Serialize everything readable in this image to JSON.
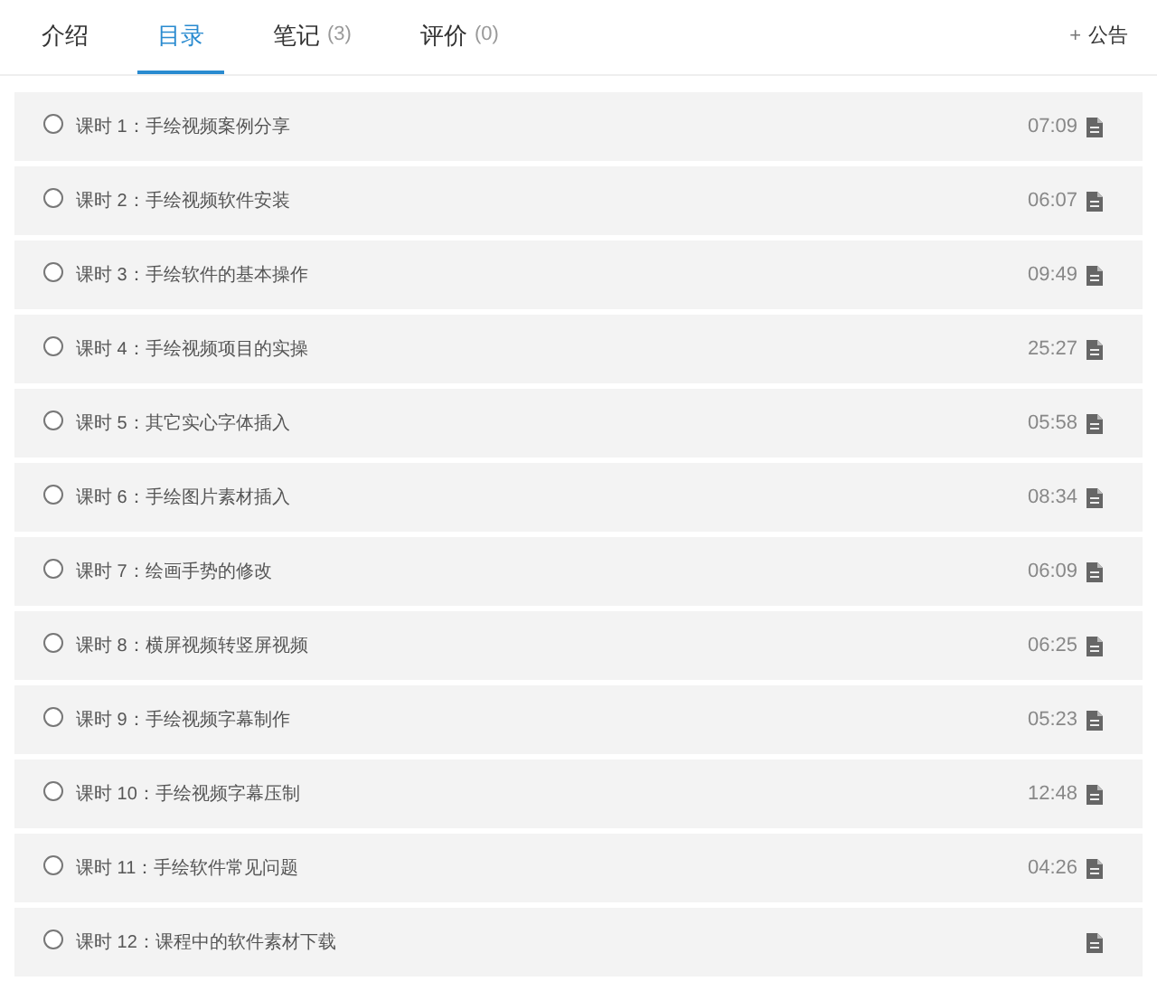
{
  "tabs": [
    {
      "label": "介绍",
      "selected": false
    },
    {
      "label": "目录",
      "selected": true
    },
    {
      "label": "笔记",
      "count": "(3)",
      "selected": false
    },
    {
      "label": "评价",
      "count": "(0)",
      "selected": false
    }
  ],
  "notice_button": {
    "icon": "+",
    "label": "公告"
  },
  "lessons": [
    {
      "title": "课时 1：手绘视频案例分享",
      "duration": "07:09"
    },
    {
      "title": "课时 2：手绘视频软件安装",
      "duration": "06:07"
    },
    {
      "title": "课时 3：手绘软件的基本操作",
      "duration": "09:49"
    },
    {
      "title": "课时 4：手绘视频项目的实操",
      "duration": "25:27"
    },
    {
      "title": "课时 5：其它实心字体插入",
      "duration": "05:58"
    },
    {
      "title": "课时 6：手绘图片素材插入",
      "duration": "08:34"
    },
    {
      "title": "课时 7：绘画手势的修改",
      "duration": "06:09"
    },
    {
      "title": "课时 8：横屏视频转竖屏视频",
      "duration": "06:25"
    },
    {
      "title": "课时 9：手绘视频字幕制作",
      "duration": "05:23"
    },
    {
      "title": "课时 10：手绘视频字幕压制",
      "duration": "12:48"
    },
    {
      "title": "课时 11：手绘软件常见问题",
      "duration": "04:26"
    },
    {
      "title": "课时 12：课程中的软件素材下载"
    }
  ]
}
